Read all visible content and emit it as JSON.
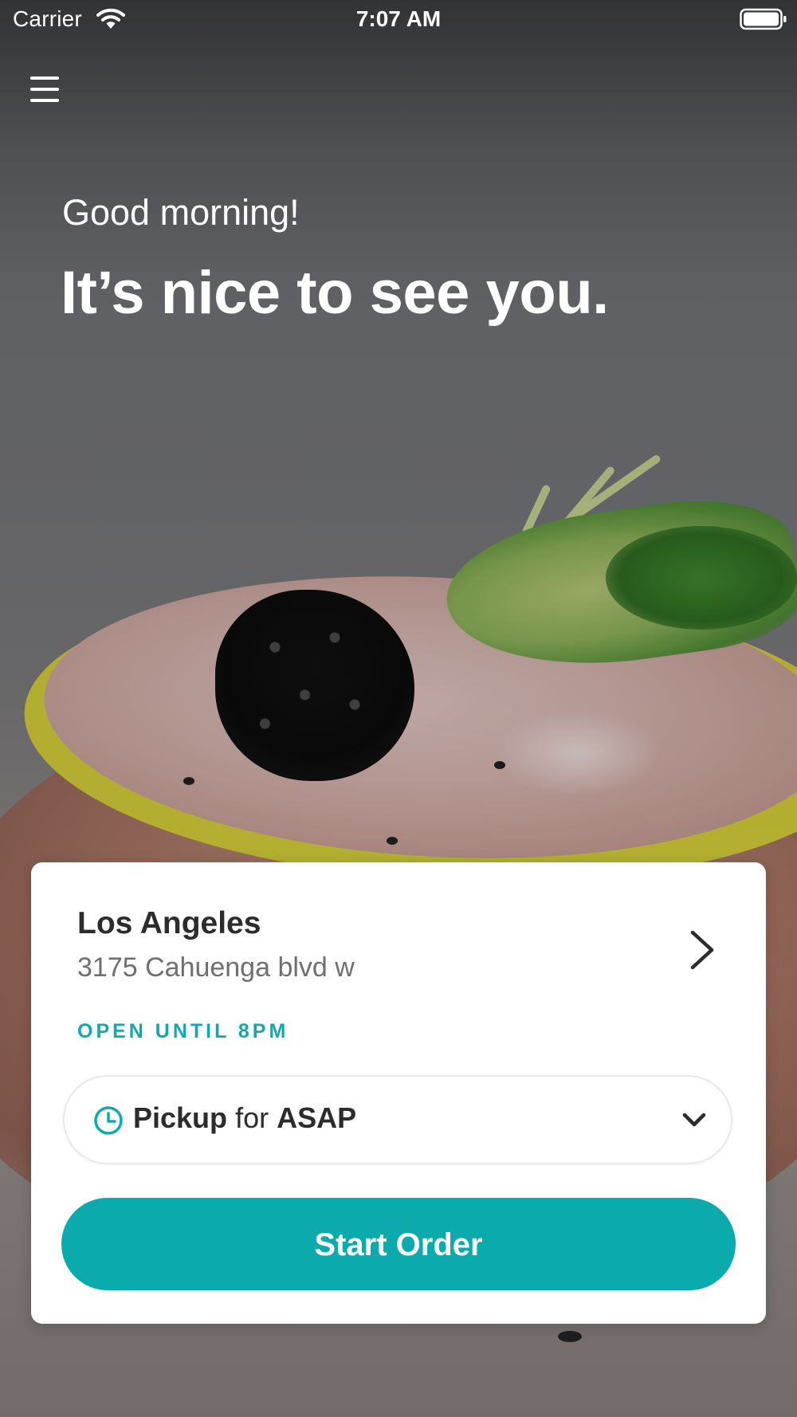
{
  "status_bar": {
    "carrier": "Carrier",
    "time": "7:07 AM",
    "icons": [
      "wifi-icon",
      "battery-icon"
    ]
  },
  "header": {
    "menu_icon": "hamburger-menu-icon"
  },
  "hero": {
    "greeting": "Good morning!",
    "headline": "It’s nice to see you."
  },
  "location_card": {
    "name": "Los Angeles",
    "address": "3175 Cahuenga blvd w",
    "hours": "OPEN UNTIL 8PM",
    "order_mode": {
      "mode": "Pickup",
      "connector": "for",
      "time": "ASAP"
    },
    "start_button_label": "Start Order"
  },
  "colors": {
    "accent": "#0AAAAD",
    "card_background": "#FFFFFF",
    "primary_text": "#2C2C2C",
    "secondary_text": "#6F6F6F"
  }
}
